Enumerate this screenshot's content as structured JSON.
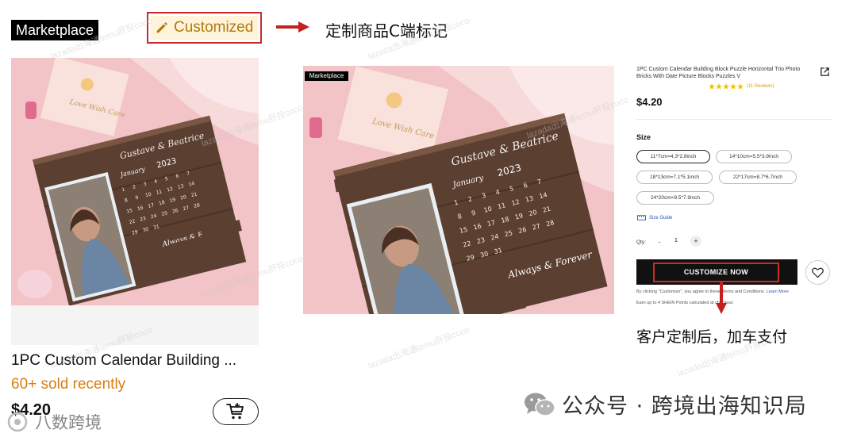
{
  "left_card": {
    "marketplace_tag": "Marketplace",
    "customized_label": "Customized",
    "product_title": "1PC Custom Calendar Building ...",
    "sold_text": "60+ sold recently",
    "price": "$4.20"
  },
  "annotations": {
    "top_note": "定制商品C端标记",
    "bottom_note": "客户定制后，加车支付"
  },
  "photo": {
    "names": "Gustave & Beatrice",
    "year": "2023",
    "month": "January",
    "phrase": "Always & Forever",
    "coaster_text": "Love Wish Care",
    "calendar_days": [
      "1",
      "2",
      "3",
      "4",
      "5",
      "6",
      "7",
      "8",
      "9",
      "10",
      "11",
      "12",
      "13",
      "14",
      "15",
      "16",
      "17",
      "18",
      "19",
      "20",
      "21",
      "22",
      "23",
      "24",
      "25",
      "26",
      "27",
      "28",
      "29",
      "30",
      "31"
    ]
  },
  "detail": {
    "marketplace_tag": "Marketplace",
    "title": "1PC Custom Calendar Building Block Puzzle Horizontal Trio Photo Bricks With Date Picture Blocks Puzzles V",
    "rating_stars": 5,
    "reviews": "(11 Reviews)",
    "price": "$4.20",
    "size_label": "Size",
    "sizes": [
      "11*7cm=4.3*2.8inch",
      "14*10cm=5.5*3.9inch",
      "18*13cm=7.1*5.1inch",
      "22*17cm=8.7*6.7inch",
      "24*20cm=9.5*7.9inch"
    ],
    "selected_size_index": 0,
    "size_guide": "Size Guide",
    "qty_label": "Qty:",
    "qty_minus": "-",
    "qty_value": "1",
    "qty_plus": "+",
    "cta_label": "CUSTOMIZE NOW",
    "terms_text": "By clicking \"Customize\", you agree to these Terms and Conditions.",
    "terms_more": "Learn More",
    "points_text": "Earn up to 4 SHEIN Points calculated at checkout."
  },
  "watermarks": {
    "tile_text": "lazada出海通temu肝投coco",
    "bottom_left": "八数跨境",
    "wechat": "公众号 · 跨境出海知识局"
  },
  "colors": {
    "accent_red": "#cc2a2a",
    "sold_orange": "#d67d12",
    "customized_bg": "#fff3d9",
    "star_yellow": "#f2c200",
    "link_blue": "#2a56b5",
    "photo_pink": "#f2c4c8"
  },
  "icons": [
    "pencil-icon",
    "arrow-right-icon",
    "cart-add-icon",
    "share-icon",
    "star-icon",
    "ruler-icon",
    "heart-icon",
    "arrow-down-icon",
    "wechat-icon"
  ]
}
